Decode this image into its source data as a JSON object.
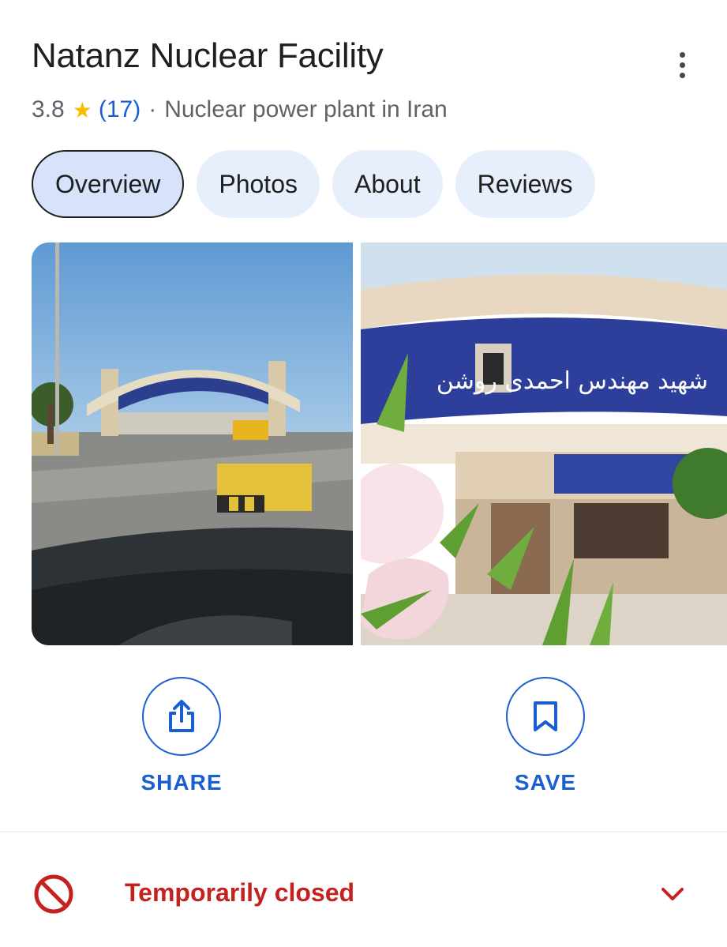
{
  "header": {
    "title": "Natanz Nuclear Facility",
    "rating": "3.8",
    "rating_star": "★",
    "review_count": "(17)",
    "separator": "·",
    "category": "Nuclear power plant in Iran",
    "more_icon": "more-vert-icon"
  },
  "tabs": [
    {
      "label": "Overview",
      "active": true
    },
    {
      "label": "Photos",
      "active": false
    },
    {
      "label": "About",
      "active": false
    },
    {
      "label": "Reviews",
      "active": false
    }
  ],
  "photos": [
    {
      "description": "facility-entrance-gate-from-car"
    },
    {
      "description": "facility-entrance-sign-with-flowers"
    }
  ],
  "photo_sign_text": "شهید مهندس احمدی روشن",
  "actions": {
    "share_label": "SHARE",
    "share_icon": "share-icon",
    "save_label": "SAVE",
    "save_icon": "bookmark-icon"
  },
  "status": {
    "text": "Temporarily closed",
    "icon": "blocked-icon",
    "expand_icon": "chevron-down-icon"
  },
  "colors": {
    "accent": "#1a5fd0",
    "star": "#fbbc04",
    "closed": "#c5221f",
    "chip_bg": "#e8effc",
    "chip_active_bg": "#d6e3fb"
  }
}
